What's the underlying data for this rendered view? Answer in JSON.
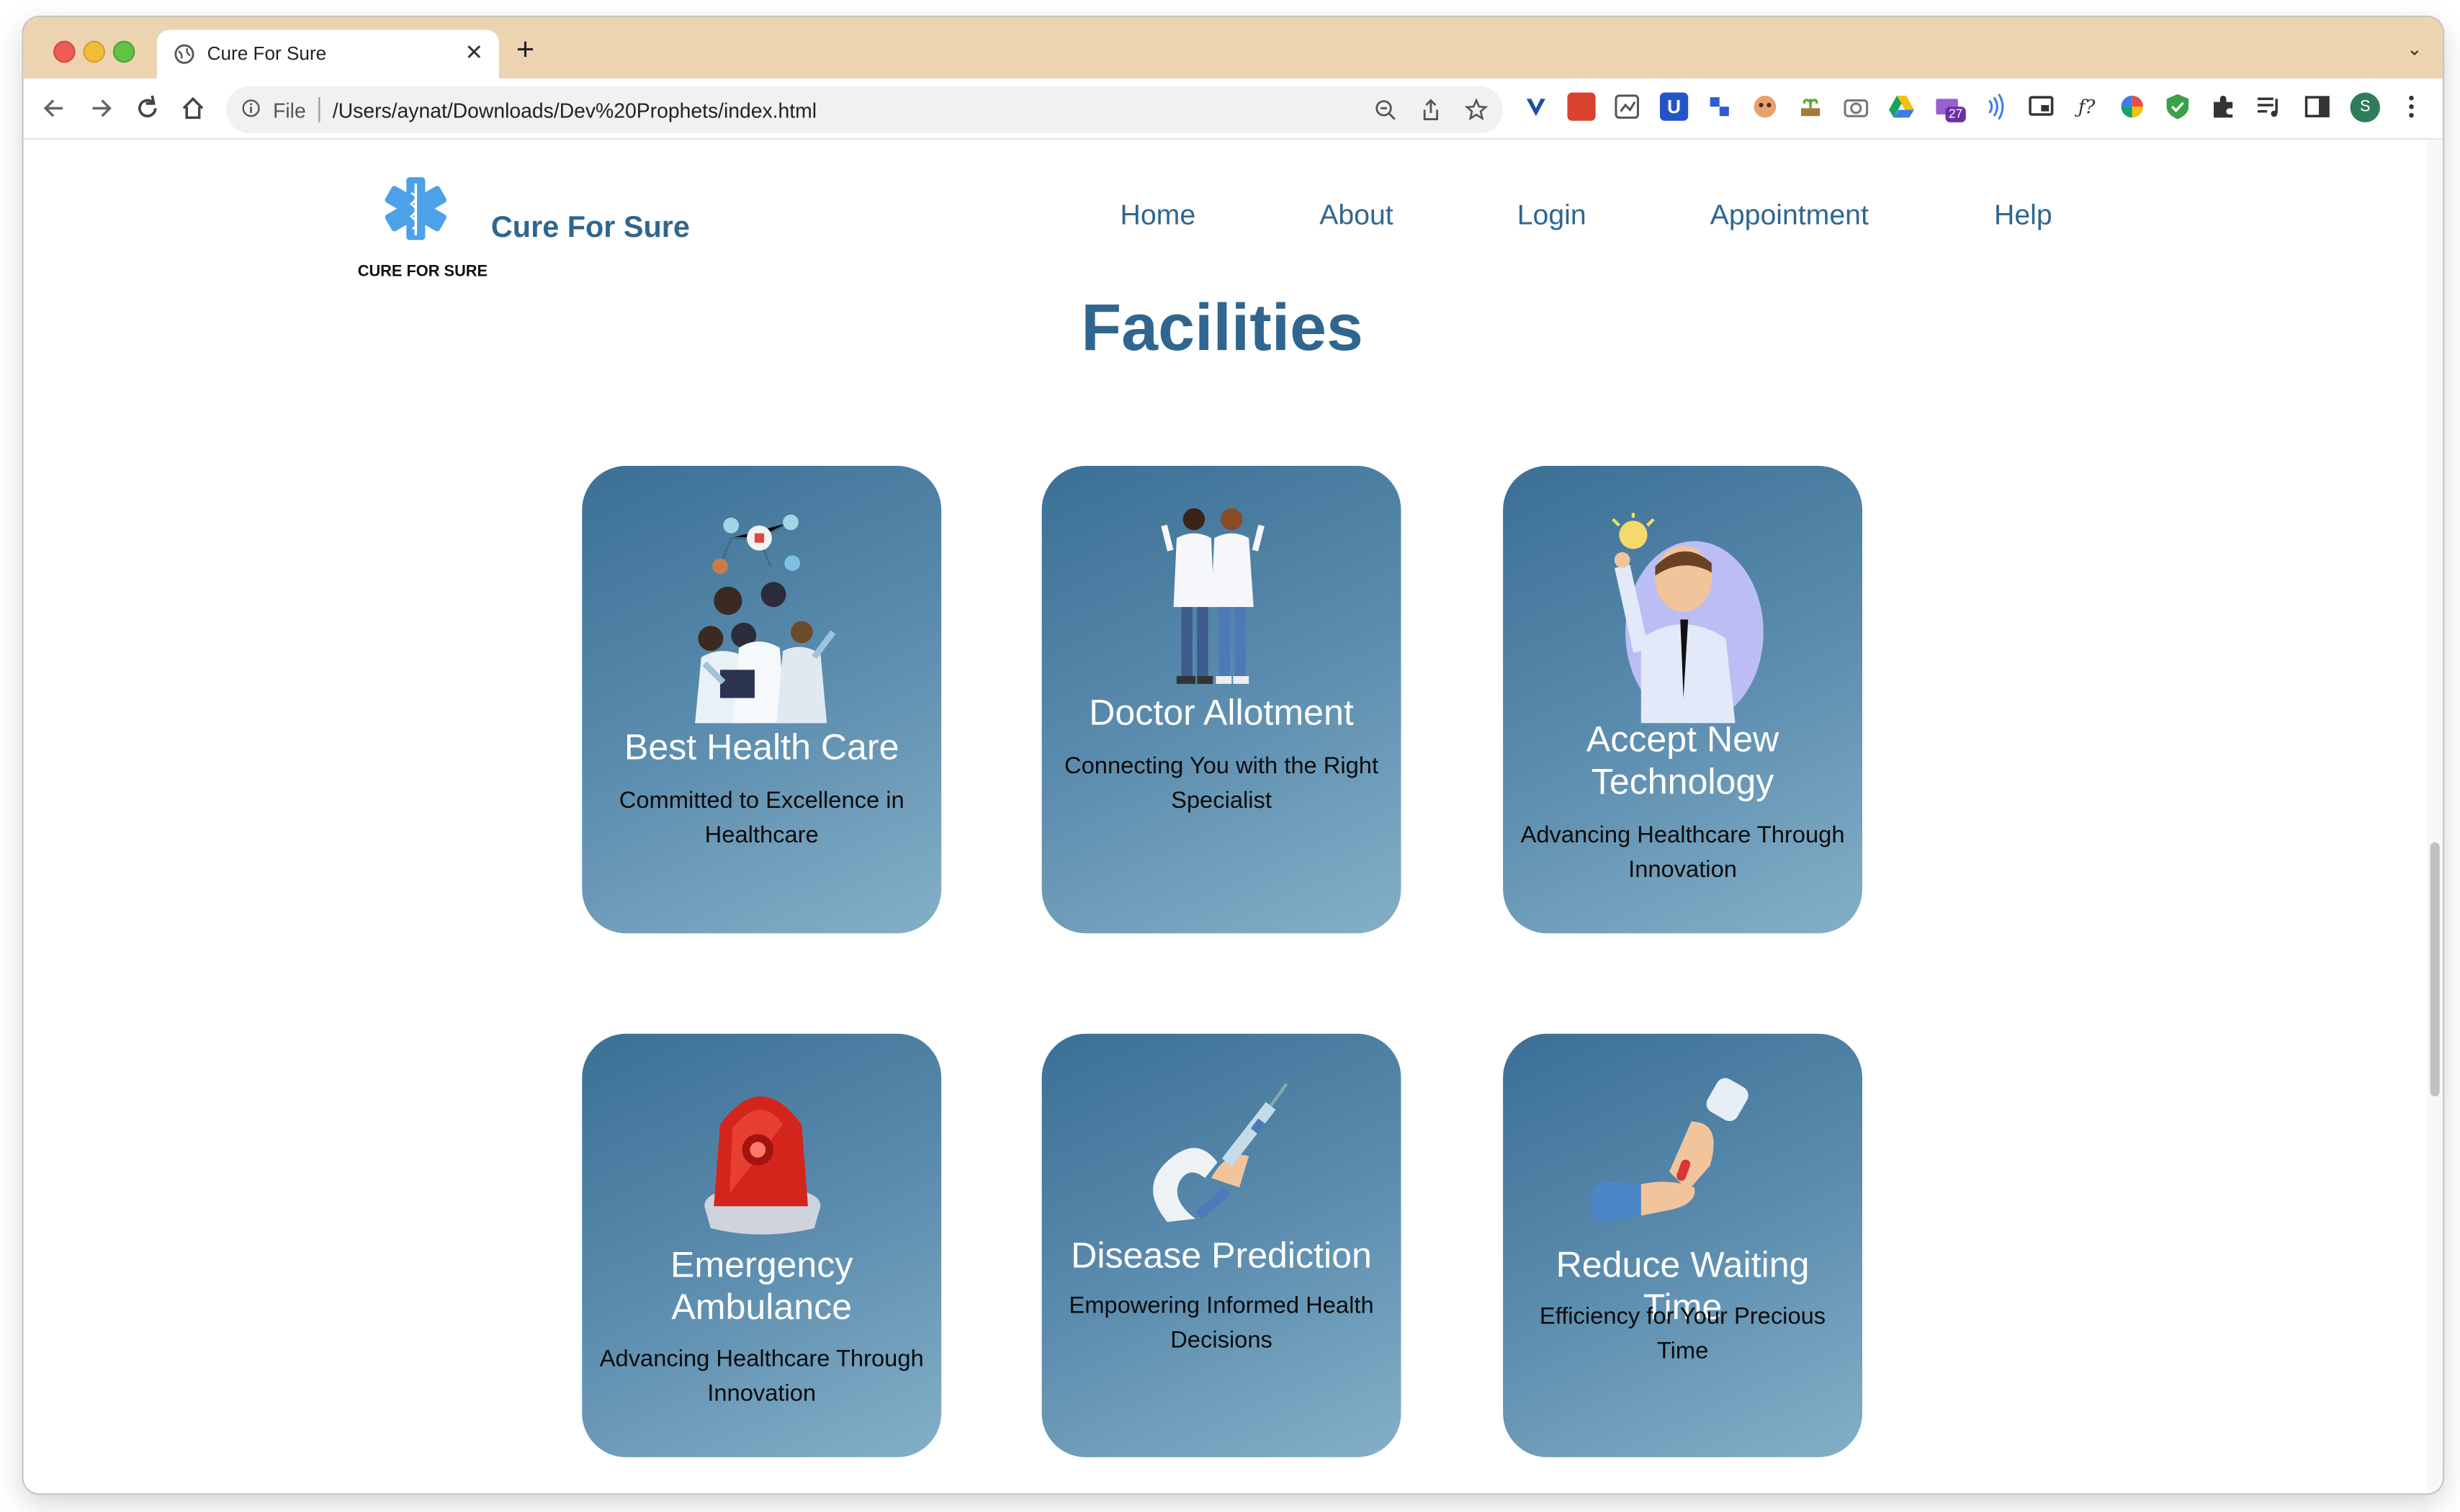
{
  "browser": {
    "tab_title": "Cure For Sure",
    "tab_close": "✕",
    "new_tab": "+",
    "tab_menu": "⌄",
    "omnibox_scheme": "File",
    "url": "/Users/aynat/Downloads/Dev%20Prophets/index.html",
    "downloads_badge": "27",
    "profile_initial": "S"
  },
  "site": {
    "logo_caption": "CURE FOR SURE",
    "brand_name": "Cure For Sure",
    "nav": [
      "Home",
      "About",
      "Login",
      "Appointment",
      "Help"
    ]
  },
  "facilities": {
    "heading": "Facilities",
    "cards": [
      {
        "title": "Best Health Care",
        "desc": "Committed to Excellence in Healthcare",
        "icon": "medical-team-illustration"
      },
      {
        "title": "Doctor Allotment",
        "desc": "Connecting You with the Right Specialist",
        "icon": "two-doctors-illustration"
      },
      {
        "title": "Accept New Technology",
        "desc": "Advancing Healthcare Through Innovation",
        "icon": "man-with-lightbulb-illustration"
      },
      {
        "title": "Emergency Ambulance",
        "desc": "Advancing Healthcare Through Innovation",
        "icon": "siren-light-illustration"
      },
      {
        "title": "Disease Prediction",
        "desc": "Empowering Informed Health Decisions",
        "icon": "hand-with-syringe-illustration"
      },
      {
        "title": "Reduce Waiting Time",
        "desc": "Efficiency for Your Precious Time",
        "icon": "hands-passing-pill-illustration"
      }
    ]
  },
  "colors": {
    "tab_bar": "#ecd4b0",
    "brand_blue": "#2f6690",
    "card_gradient_start": "#3b6f95",
    "card_gradient_end": "#84afc7"
  }
}
